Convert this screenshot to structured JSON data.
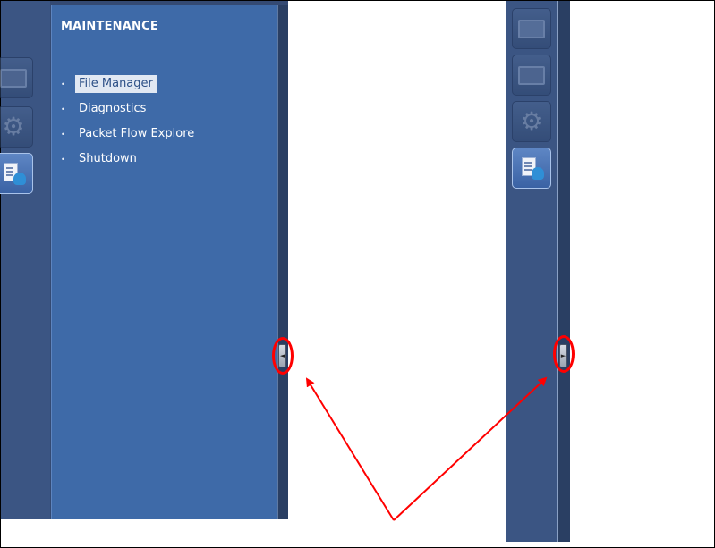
{
  "left_panel": {
    "title": "MAINTENANCE",
    "menu": [
      {
        "label": "File Manager",
        "selected": true
      },
      {
        "label": "Diagnostics",
        "selected": false
      },
      {
        "label": "Packet Flow Explore",
        "selected": false
      },
      {
        "label": "Shutdown",
        "selected": false
      }
    ],
    "collapse_toggle_glyph": "◄",
    "icons": [
      "monitor-icon",
      "gear-icon",
      "maintenance-icon"
    ]
  },
  "right_panel": {
    "expand_toggle_glyph": "►",
    "icons": [
      "dashboard-icon",
      "monitor-icon",
      "gear-icon",
      "maintenance-icon"
    ]
  },
  "annotation": {
    "circle_color": "#ff0000",
    "arrow_color": "#ff0000"
  }
}
